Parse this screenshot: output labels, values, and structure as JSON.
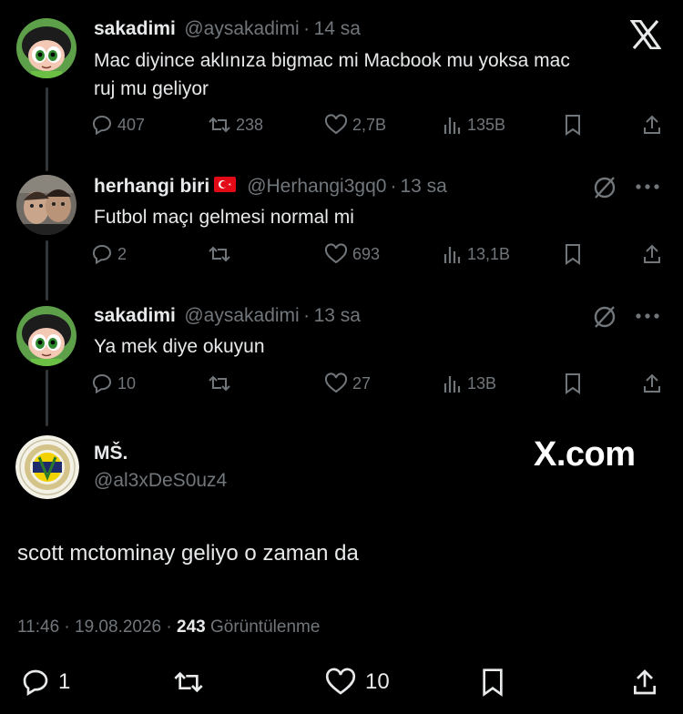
{
  "thread": [
    {
      "name": "sakadimi",
      "handle": "@aysakadimi",
      "time": "14 sa",
      "text_lines": [
        "Mac diyince aklınıza bigmac mi Macbook mu yoksa mac",
        "ruj mu geliyor"
      ],
      "replies": "407",
      "reposts": "238",
      "likes": "2,7B",
      "views": "135B"
    },
    {
      "name": "herhangi biri",
      "handle": "@Herhangi3gq0",
      "time": "13 sa",
      "text_lines": [
        "Futbol maçı gelmesi normal mi"
      ],
      "replies": "2",
      "reposts": "",
      "likes": "693",
      "views": "13,1B"
    },
    {
      "name": "sakadimi",
      "handle": "@aysakadimi",
      "time": "13 sa",
      "text_lines": [
        "Ya mek diye okuyun"
      ],
      "replies": "10",
      "reposts": "",
      "likes": "27",
      "views": "13B"
    }
  ],
  "main_tweet": {
    "name": "MŠ.",
    "handle": "@al3xDeS0uz4",
    "text": "scott mctominay geliyo o zaman da",
    "time": "11:46 · 19.08.2026 ·",
    "views_count": "243",
    "views_label": "Görüntülenme",
    "replies": "1",
    "likes": "10"
  },
  "watermark": "X.com",
  "separator": "·",
  "icons": {
    "top_right": "x-logo-icon",
    "reply": "speech-bubble-icon",
    "repost": "repost-arrows-icon",
    "like": "heart-icon",
    "views": "bar-chart-icon",
    "bookmark": "bookmark-icon",
    "share": "share-upload-icon",
    "grok": "grok-slash-icon",
    "more": "three-dots-icon"
  },
  "colors": {
    "background": "#000000",
    "text": "#e7e9ea",
    "secondary": "#71767b",
    "line": "#333639"
  }
}
